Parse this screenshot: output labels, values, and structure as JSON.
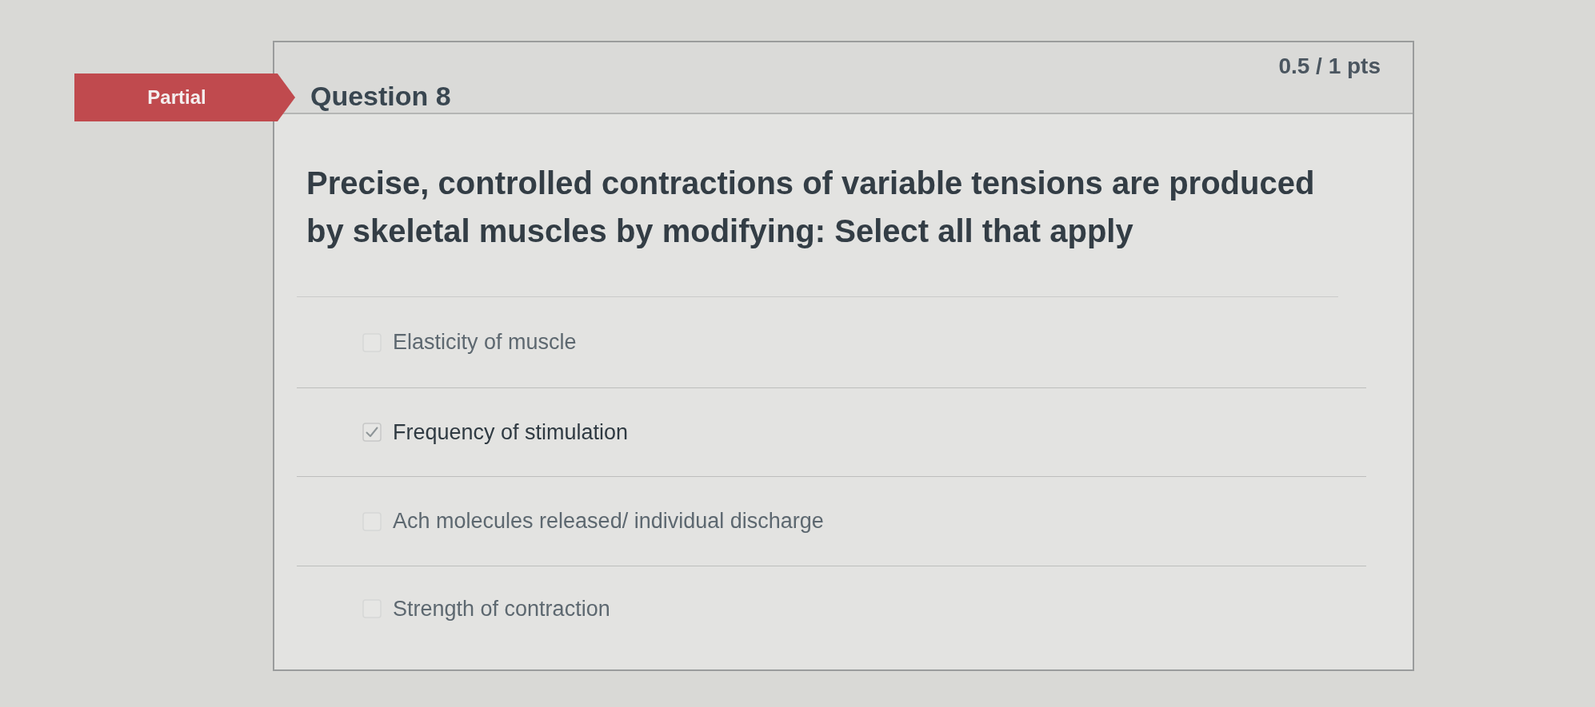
{
  "question": {
    "status": "Partial",
    "title": "Question 8",
    "points": "0.5 / 1 pts",
    "text": "Precise, controlled contractions of variable tensions are produced by skeletal muscles by modifying: Select all that apply",
    "answers": [
      {
        "label": "Elasticity of muscle",
        "checked": false
      },
      {
        "label": "Frequency of stimulation",
        "checked": true
      },
      {
        "label": "Ach molecules released/ individual discharge",
        "checked": false
      },
      {
        "label": "Strength of contraction",
        "checked": false
      }
    ]
  }
}
